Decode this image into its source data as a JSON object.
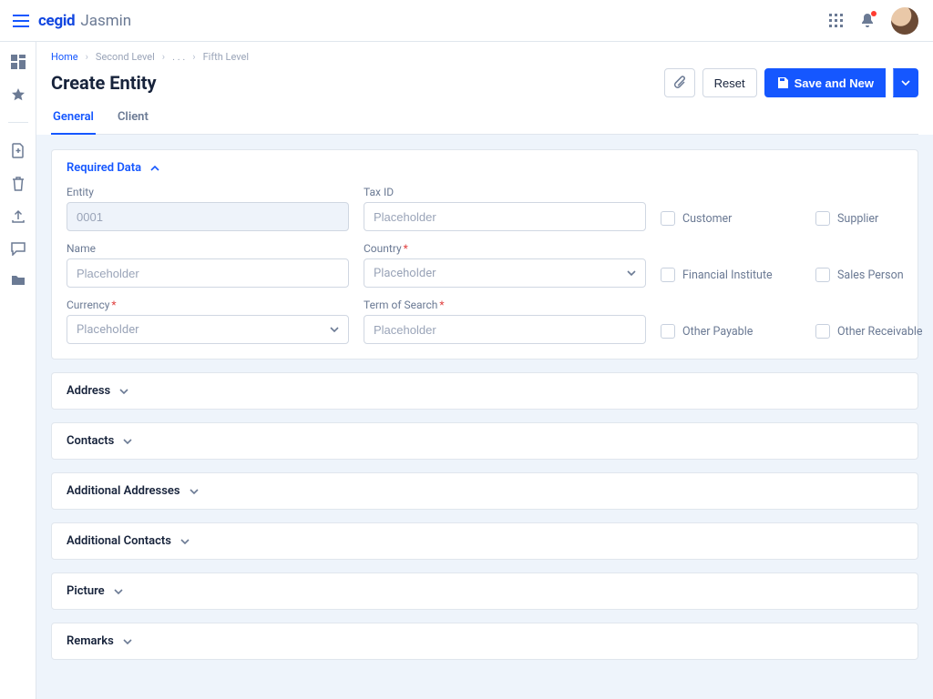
{
  "brand": {
    "company": "cegid",
    "product": "Jasmin"
  },
  "breadcrumb": {
    "home": "Home",
    "second": "Second Level",
    "ellipsis": ". . .",
    "fifth": "Fifth Level"
  },
  "page": {
    "title": "Create Entity"
  },
  "actions": {
    "reset": "Reset",
    "save_and_new": "Save and New"
  },
  "tabs": {
    "general": "General",
    "client": "Client"
  },
  "sections": {
    "required": "Required Data",
    "address": "Address",
    "contacts": "Contacts",
    "addl_addresses": "Additional Addresses",
    "addl_contacts": "Additional Contacts",
    "picture": "Picture",
    "remarks": "Remarks"
  },
  "fields": {
    "entity_label": "Entity",
    "entity_value": "0001",
    "taxid_label": "Tax ID",
    "name_label": "Name",
    "country_label": "Country",
    "currency_label": "Currency",
    "term_label": "Term of Search",
    "placeholder": "Placeholder"
  },
  "checks": {
    "customer": "Customer",
    "supplier": "Supplier",
    "financial_institute": "Financial Institute",
    "sales_person": "Sales Person",
    "other_payable": "Other Payable",
    "other_receivable": "Other Receivable"
  }
}
